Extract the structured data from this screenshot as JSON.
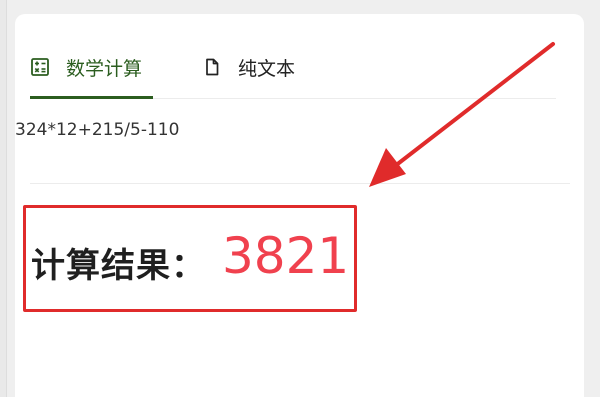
{
  "tabs": [
    {
      "label": "数学计算",
      "icon": "calculator-icon",
      "active": true
    },
    {
      "label": "纯文本",
      "icon": "document-icon",
      "active": false
    }
  ],
  "expression": "324*12+215/5-110",
  "result": {
    "label": "计算结果：",
    "value": "3821"
  },
  "colors": {
    "active_tab": "#2b5d1f",
    "highlight": "#e02b2b",
    "result_value": "#f0414e"
  }
}
